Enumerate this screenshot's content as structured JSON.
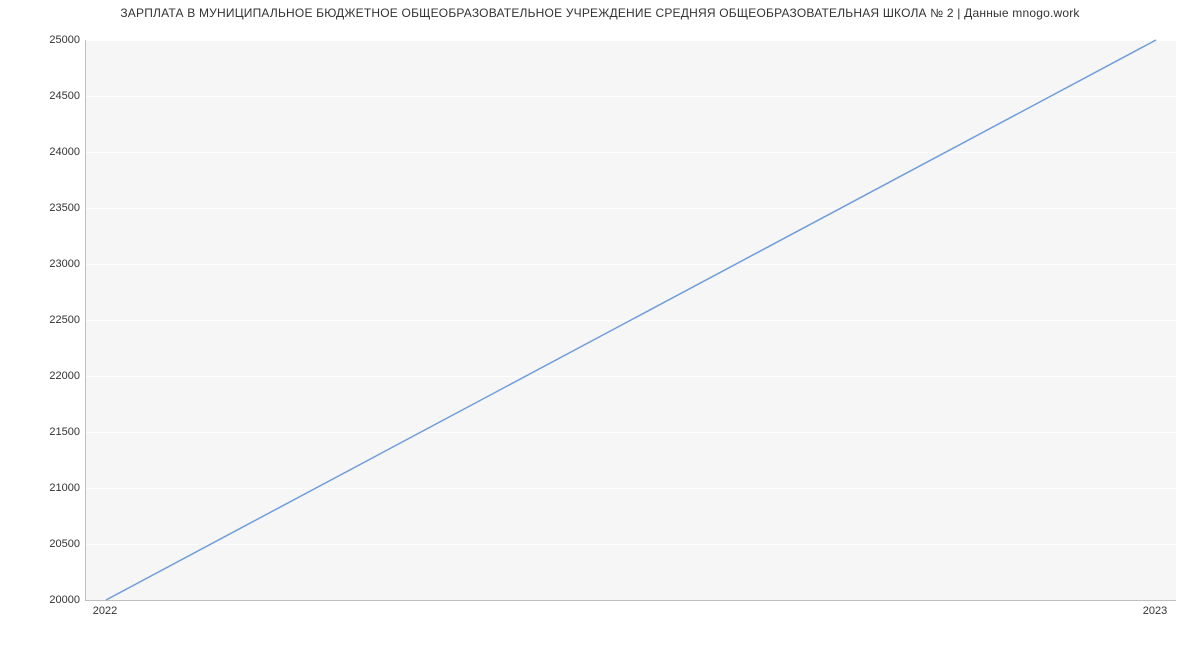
{
  "chart_data": {
    "type": "line",
    "title": "ЗАРПЛАТА В МУНИЦИПАЛЬНОЕ БЮДЖЕТНОЕ ОБЩЕОБРАЗОВАТЕЛЬНОЕ УЧРЕЖДЕНИЕ СРЕДНЯЯ ОБЩЕОБРАЗОВАТЕЛЬНАЯ ШКОЛА № 2 | Данные mnogo.work",
    "xlabel": "",
    "ylabel": "",
    "x_categories": [
      "2022",
      "2023"
    ],
    "y_ticks": [
      20000,
      20500,
      21000,
      21500,
      22000,
      22500,
      23000,
      23500,
      24000,
      24500,
      25000
    ],
    "ylim": [
      20000,
      25000
    ],
    "series": [
      {
        "name": "salary",
        "values": [
          20000,
          25000
        ],
        "color": "#6f9ddb"
      }
    ]
  }
}
